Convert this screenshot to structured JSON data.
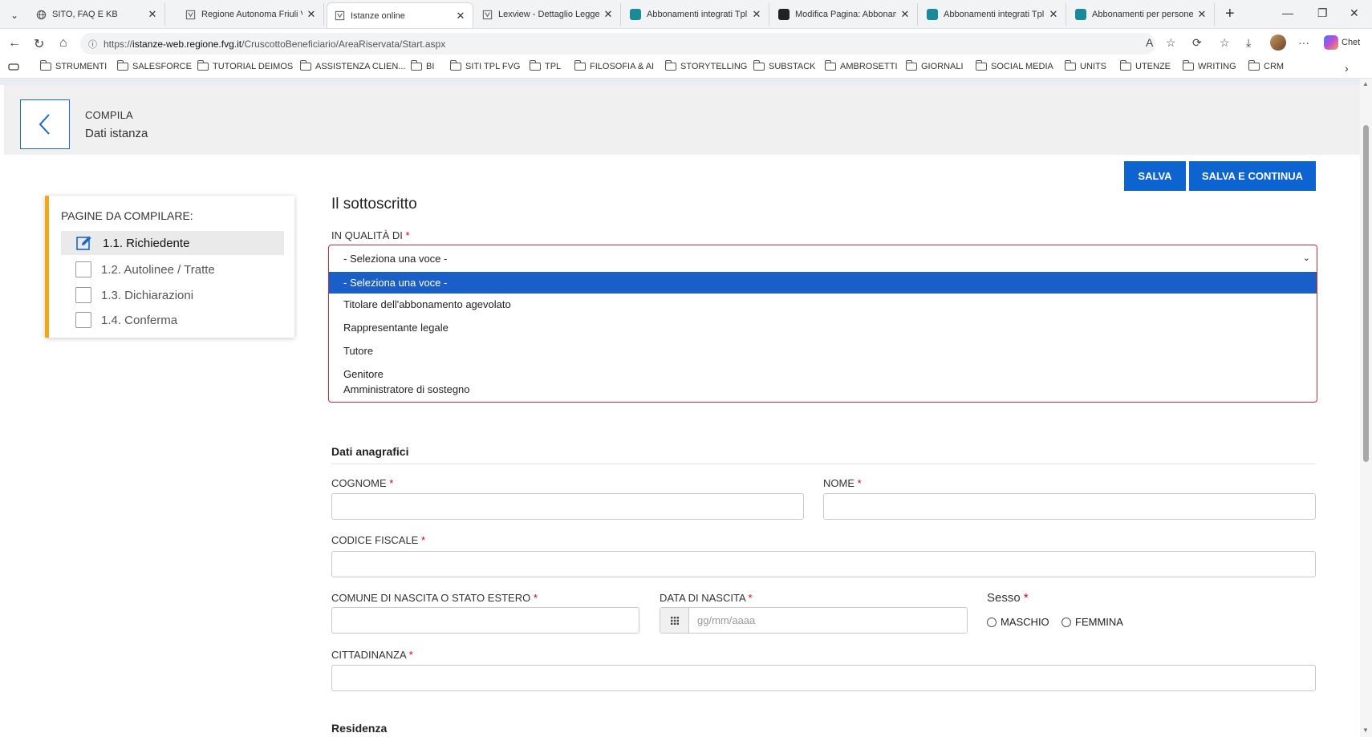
{
  "browser": {
    "tabs": [
      {
        "label": "SITO, FAQ E KB",
        "favicon": "globe-icon",
        "color": "#555555"
      },
      {
        "label": "Regione Autonoma Friuli Ven",
        "favicon": "eagle-icon",
        "color": "#666666"
      },
      {
        "label": "Istanze online",
        "favicon": "eagle-icon",
        "color": "#666666",
        "active": true
      },
      {
        "label": "Lexview - Dettaglio Legge re",
        "favicon": "eagle-icon",
        "color": "#666666"
      },
      {
        "label": "Abbonamenti integrati Tpl F",
        "favicon": "site-icon",
        "color": "#1a8a9a"
      },
      {
        "label": "Modifica Pagina: Abboname",
        "favicon": "site-icon",
        "color": "#222222"
      },
      {
        "label": "Abbonamenti integrati Tpl F",
        "favicon": "site-icon",
        "color": "#1a8a9a"
      },
      {
        "label": "Abbonamenti per persone c",
        "favicon": "site-icon",
        "color": "#1a8a9a"
      }
    ],
    "url_prefix": "https://",
    "url_domain": "istanze-web.regione.fvg.it",
    "url_path": "/CruscottoBeneficiario/AreaRiservata/Start.aspx",
    "copilot_label": "Chet",
    "bookmarks": [
      "STRUMENTI",
      "SALESFORCE",
      "TUTORIAL DEIMOS",
      "ASSISTENZA CLIEN...",
      "BI",
      "SITI TPL FVG",
      "TPL",
      "FILOSOFIA & AI",
      "STORYTELLING",
      "SUBSTACK",
      "AMBROSETTI",
      "GIORNALI",
      "SOCIAL MEDIA",
      "UNITS",
      "UTENZE",
      "WRITING",
      "CRM"
    ]
  },
  "header": {
    "kicker": "COMPILA",
    "title": "Dati istanza"
  },
  "actions": {
    "save": "SALVA",
    "save_continue": "SALVA E CONTINUA"
  },
  "sidebar": {
    "title": "PAGINE DA COMPILARE:",
    "items": [
      {
        "label": "1.1. Richiedente",
        "current": true
      },
      {
        "label": "1.2. Autolinee / Tratte",
        "current": false
      },
      {
        "label": "1.3. Dichiarazioni",
        "current": false
      },
      {
        "label": "1.4. Conferma",
        "current": false
      }
    ]
  },
  "form": {
    "section_title": "Il sottoscritto",
    "qualita_label": "IN QUALITÀ DI",
    "required_mark": "*",
    "select": {
      "current": "- Seleziona una voce -",
      "options": [
        "- Seleziona una voce -",
        "Titolare dell'abbonamento agevolato",
        "Rappresentante legale",
        "Tutore",
        "Genitore",
        "Amministratore di sostegno"
      ],
      "highlighted_index": 0
    },
    "anagrafici_title": "Dati anagrafici",
    "cognome_label": "COGNOME",
    "nome_label": "NOME",
    "codice_fiscale_label": "CODICE FISCALE",
    "comune_label": "COMUNE DI NASCITA O STATO ESTERO",
    "data_nascita_label": "DATA DI NASCITA",
    "data_placeholder": "gg/mm/aaaa",
    "sesso_label": "Sesso",
    "sesso_options": [
      "MASCHIO",
      "FEMMINA"
    ],
    "cittadinanza_label": "CITTADINANZA",
    "residenza_title": "Residenza"
  },
  "colors": {
    "primary": "#0d63cf",
    "accent_border": "#f0a81b",
    "error": "#e0232f",
    "option_highlight": "#1a5fc8"
  }
}
